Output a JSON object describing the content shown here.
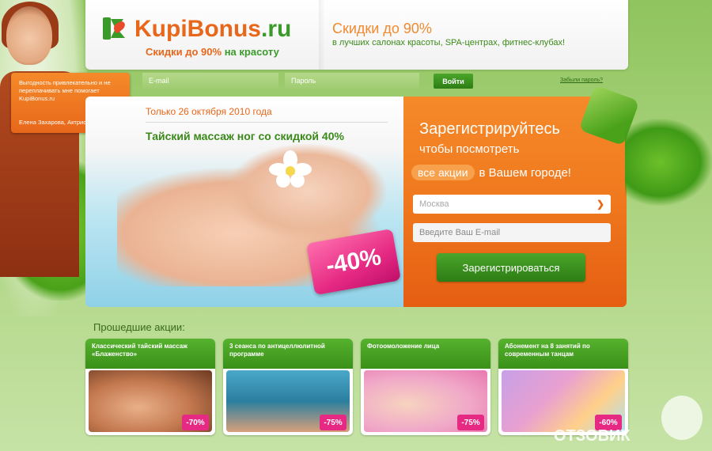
{
  "celebrity_quote": {
    "text": "Выгодность привлекательно и не переплачивать мне помогает KupiBonus.ru",
    "author": "Елена Захарова, Актриса"
  },
  "header": {
    "logo_name": "KupiBonus",
    "logo_domain": ".ru",
    "tagline_lead": "Скидки до 90%",
    "tagline_tail": "на красоту",
    "promo_title": "Скидки до 90%",
    "promo_subtitle": "в лучших салонах красоты, SPA-центрах, фитнес-клубах!"
  },
  "login": {
    "email_placeholder": "E-mail",
    "password_placeholder": "Пароль",
    "button_label": "Войти",
    "forgot_label": "Забыли пароль?"
  },
  "promo": {
    "date": "Только 26 октября 2010 года",
    "title_lead": "Тайский массаж ног со",
    "title_accent": "скидкой 40%",
    "discount": "-40%"
  },
  "register": {
    "title": "Зарегистрируйтесь",
    "subtitle": "чтобы посмотреть",
    "pill": "все акции",
    "line3_tail": "в Вашем городе!",
    "city": "Москва",
    "email_placeholder": "Введите Ваш E-mail",
    "button_label": "Зарегистрироваться"
  },
  "past": {
    "title": "Прошедшие акции:",
    "items": [
      {
        "title": "Классический тайский массаж «Блаженство»",
        "discount": "-70%"
      },
      {
        "title": "3 сеанса по антицеллюлитной программе",
        "discount": "-75%"
      },
      {
        "title": "Фотоомоложение лица",
        "discount": "-75%"
      },
      {
        "title": "Абонемент на 8 занятий по современным танцам",
        "discount": "-60%"
      }
    ]
  },
  "watermark": "ОТЗОВИК",
  "colors": {
    "brand_orange": "#e8671a",
    "brand_green": "#3a9a2a",
    "accent_pink": "#e62a84"
  }
}
